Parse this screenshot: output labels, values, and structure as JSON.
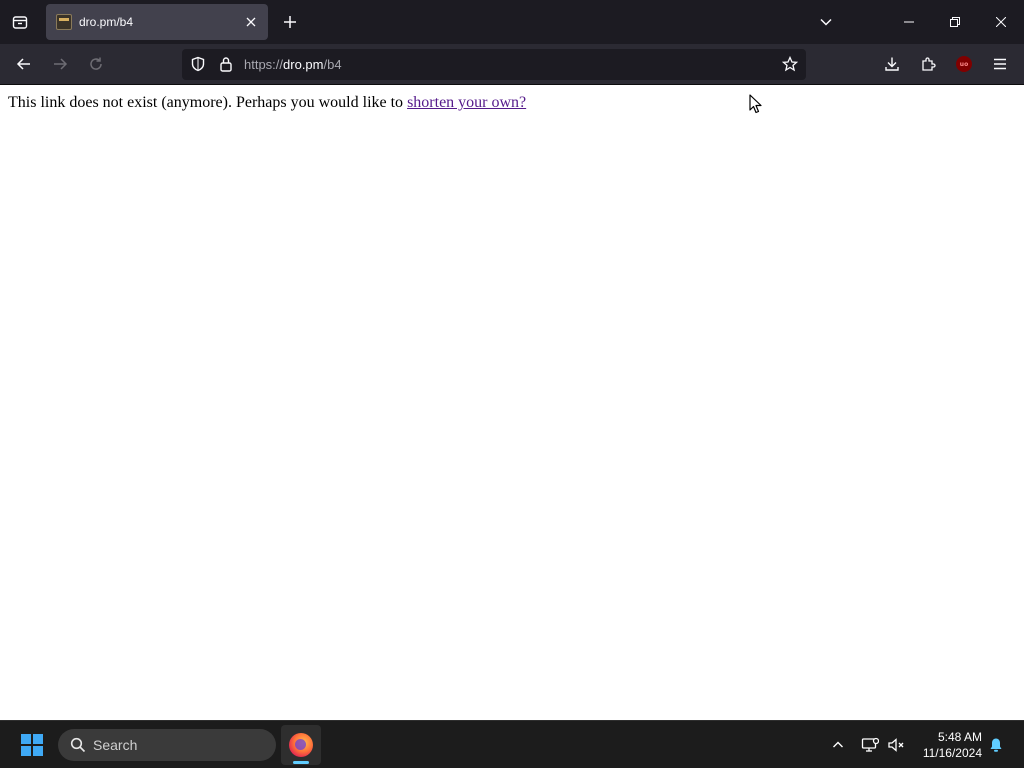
{
  "browser": {
    "tab": {
      "title": "dro.pm/b4"
    },
    "url": {
      "scheme": "https://",
      "host": "dro.pm",
      "path": "/b4"
    },
    "ublock_badge": "uo"
  },
  "page": {
    "message_text": "This link does not exist (anymore). Perhaps you would like to ",
    "link_text": "shorten your own?"
  },
  "taskbar": {
    "search_label": "Search",
    "time": "5:48 AM",
    "date": "11/16/2024"
  },
  "icons": {
    "tabs_list": "firefox-view-icon",
    "new_tab": "plus-icon",
    "list_all_tabs": "chevron-down-icon",
    "back": "arrow-left-icon",
    "forward": "arrow-right-icon",
    "reload": "reload-icon",
    "tracking": "shield-icon",
    "secure": "lock-icon",
    "bookmark": "star-icon",
    "downloads": "download-icon",
    "extensions": "puzzle-icon",
    "menu": "hamburger-icon",
    "start": "windows-logo-icon",
    "notifications": "bell-icon"
  },
  "colors": {
    "tabstrip": "#1c1b22",
    "toolbar": "#2b2a33",
    "active_tab": "#42414d",
    "visited_link": "#551a8b",
    "taskbar": "#1c1c1c",
    "accent": "#60cdff"
  }
}
